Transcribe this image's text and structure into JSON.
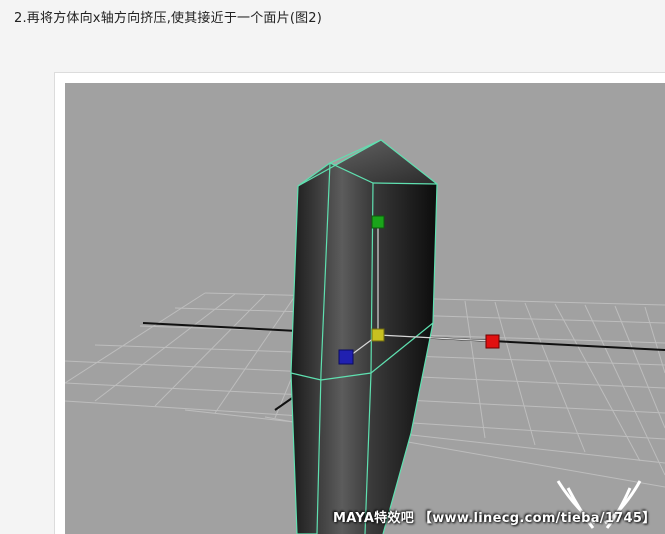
{
  "caption": "2.再将方体向x轴方向挤压,使其接近于一个面片(图2)",
  "watermark": "MAYA特效吧 【www.linecg.com/tieba/1745】",
  "manipulator": {
    "y_handle_color": "#1aa51a",
    "x_handle_color": "#e01010",
    "z_handle_color": "#2020b0",
    "center_color": "#c8c020"
  },
  "mesh": {
    "wire_color": "#5fe0b0",
    "fill_dark": "#141414",
    "fill_mid": "#5a5a5a"
  },
  "viewport_bg": "#a1a1a1"
}
